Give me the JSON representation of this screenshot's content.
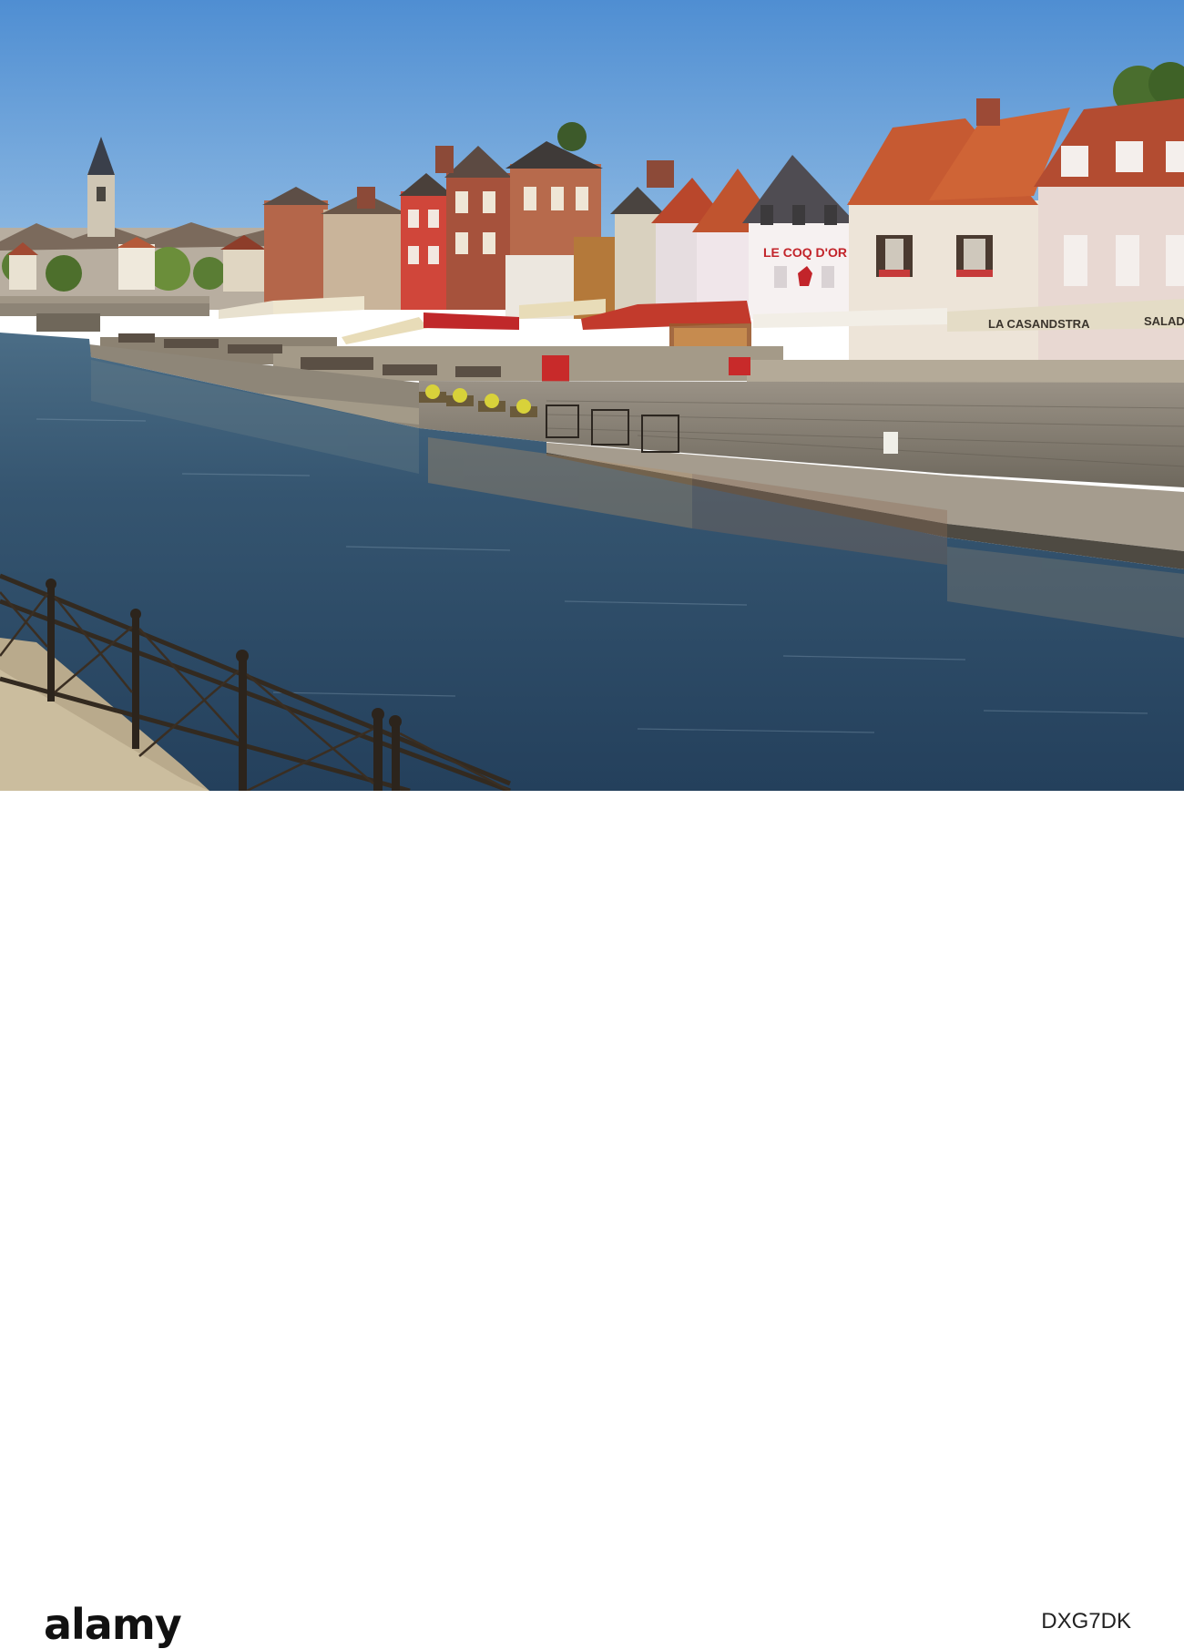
{
  "photo": {
    "subject": "Riverside quay with cafes and restaurants along a canal",
    "signs": {
      "le_coq_dor": "LE COQ D'OR",
      "la_casandstra": "LA CASANDSTRA",
      "salad": "SALAD"
    }
  },
  "watermark": {
    "brand": "alamy",
    "image_id": "DXG7DK"
  },
  "colors": {
    "sky": "#5f9ad6",
    "water": "#2c4a6a",
    "wall": "#8a8478",
    "roof_red": "#c4502e",
    "awning_red": "#c0282a",
    "awning_cream": "#e8dcb8",
    "railing": "#3a2e22"
  },
  "icons": {
    "logo": "alamy-logo"
  }
}
